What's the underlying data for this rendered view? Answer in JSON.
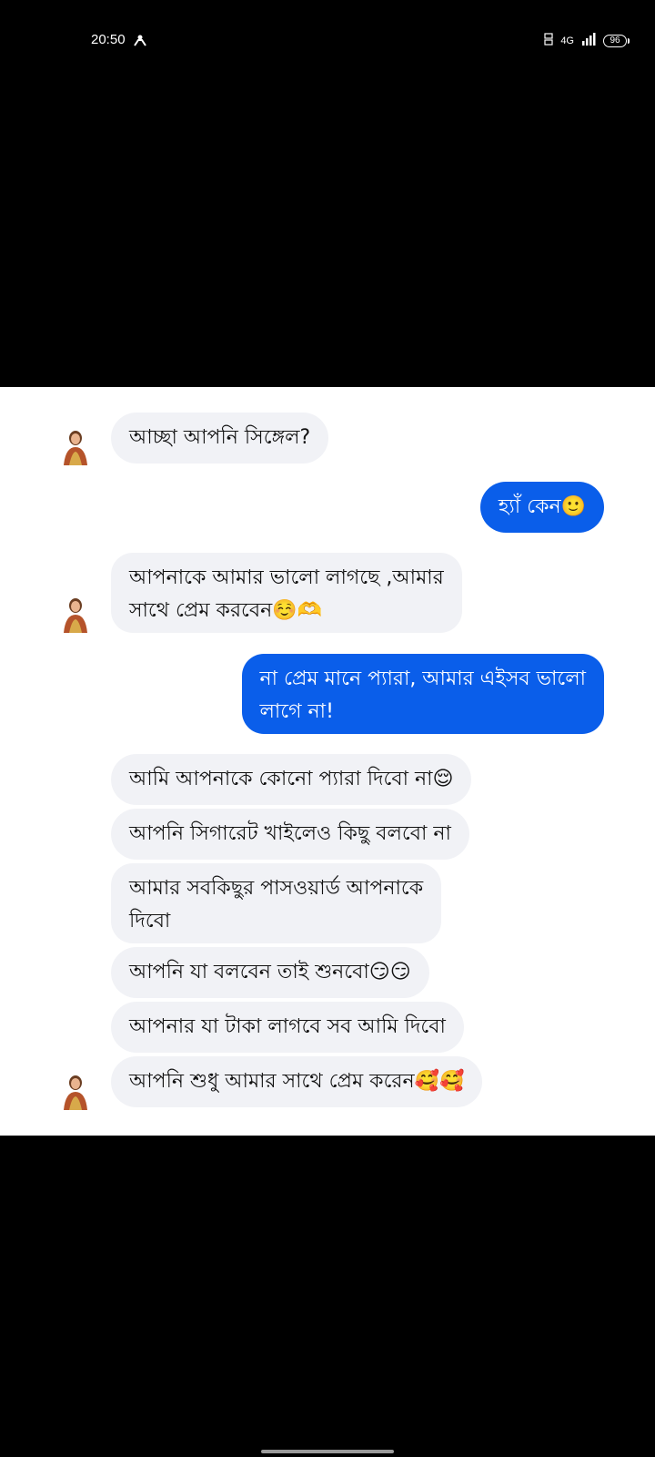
{
  "status_bar": {
    "time": "20:50",
    "network": "4G",
    "battery": "96"
  },
  "messages": [
    {
      "id": "m1",
      "sender": "them",
      "text": "আচ্ছা আপনি সিঙ্গেল?"
    },
    {
      "id": "m2",
      "sender": "me",
      "text": "হ্যাঁ কেন🙂"
    },
    {
      "id": "m3",
      "sender": "them",
      "lines": [
        "আপনাকে আমার ভালো লাগছে ,আমার",
        "সাথে প্রেম করবেন☺️🫶"
      ]
    },
    {
      "id": "m4",
      "sender": "me",
      "lines": [
        "না প্রেম মানে প্যারা, আমার এইসব ভালো",
        "লাগে না!"
      ]
    },
    {
      "id": "m5",
      "sender": "them",
      "text": "আমি আপনাকে কোনো প্যারা দিবো না😌"
    },
    {
      "id": "m6",
      "sender": "them",
      "text": "আপনি সিগারেট খাইলেও কিছু বলবো না"
    },
    {
      "id": "m7",
      "sender": "them",
      "lines": [
        "আমার সবকিছুর পাসওয়ার্ড আপনাকে",
        "দিবো"
      ]
    },
    {
      "id": "m8",
      "sender": "them",
      "text": "আপনি যা বলবেন তাই শুনবো😏😏"
    },
    {
      "id": "m9",
      "sender": "them",
      "text": "আপনার যা টাকা লাগবে সব আমি দিবো"
    },
    {
      "id": "m10",
      "sender": "them",
      "text": "আপনি শুধু আমার সাথে প্রেম করেন🥰🥰"
    }
  ]
}
